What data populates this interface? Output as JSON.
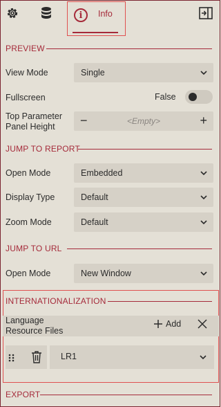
{
  "tabs": {
    "info_label": "Info"
  },
  "preview": {
    "header": "PREVIEW",
    "view_mode_label": "View Mode",
    "view_mode_value": "Single",
    "fullscreen_label": "Fullscreen",
    "fullscreen_value": "False",
    "top_param_label_line1": "Top Parameter",
    "top_param_label_line2": "Panel Height",
    "top_param_placeholder": "<Empty>"
  },
  "jump_to_report": {
    "header": "JUMP TO REPORT",
    "open_mode_label": "Open Mode",
    "open_mode_value": "Embedded",
    "display_type_label": "Display Type",
    "display_type_value": "Default",
    "zoom_mode_label": "Zoom Mode",
    "zoom_mode_value": "Default"
  },
  "jump_to_url": {
    "header": "JUMP TO URL",
    "open_mode_label": "Open Mode",
    "open_mode_value": "New Window"
  },
  "internationalization": {
    "header": "INTERNATIONALIZATION",
    "lang_label_line1": "Language",
    "lang_label_line2": "Resource Files",
    "add_label": "Add",
    "item_value": "LR1"
  },
  "export": {
    "header": "EXPORT"
  },
  "colors": {
    "accent": "#a52a3a",
    "highlight": "#e05050",
    "background": "#e4e0d6",
    "field": "#d6d1c7"
  }
}
